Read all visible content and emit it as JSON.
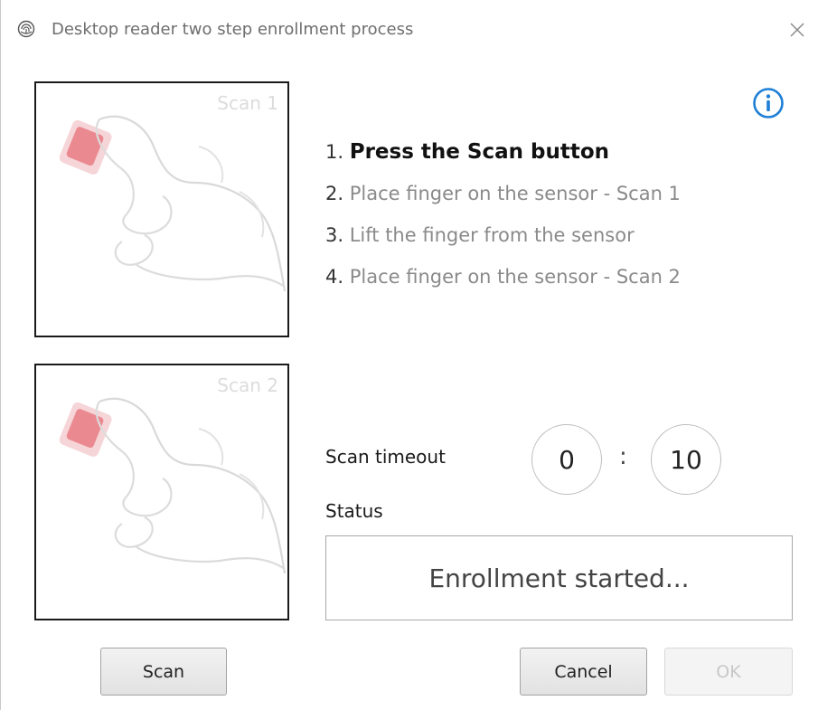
{
  "window": {
    "title": "Desktop reader two step enrollment process",
    "icon": "fingerprint-icon",
    "close_icon": "close-icon"
  },
  "scan_panels": [
    {
      "label": "Scan 1",
      "illustration": "finger-on-sensor-icon"
    },
    {
      "label": "Scan 2",
      "illustration": "finger-on-sensor-icon"
    }
  ],
  "info_icon": "info-icon",
  "steps": [
    {
      "number": "1.",
      "text": "Press the Scan button",
      "active": true
    },
    {
      "number": "2.",
      "text": "Place finger on the sensor - Scan 1",
      "active": false
    },
    {
      "number": "3.",
      "text": "Lift the finger from the sensor",
      "active": false
    },
    {
      "number": "4.",
      "text": "Place finger on the sensor - Scan 2",
      "active": false
    }
  ],
  "timeout": {
    "label": "Scan timeout",
    "minutes": "0",
    "separator": ":",
    "seconds": "10"
  },
  "status": {
    "label": "Status",
    "value": "Enrollment started..."
  },
  "buttons": {
    "scan": "Scan",
    "cancel": "Cancel",
    "ok": "OK"
  },
  "colors": {
    "accent": "#1e7fd6",
    "sensor": "#e04a56"
  }
}
